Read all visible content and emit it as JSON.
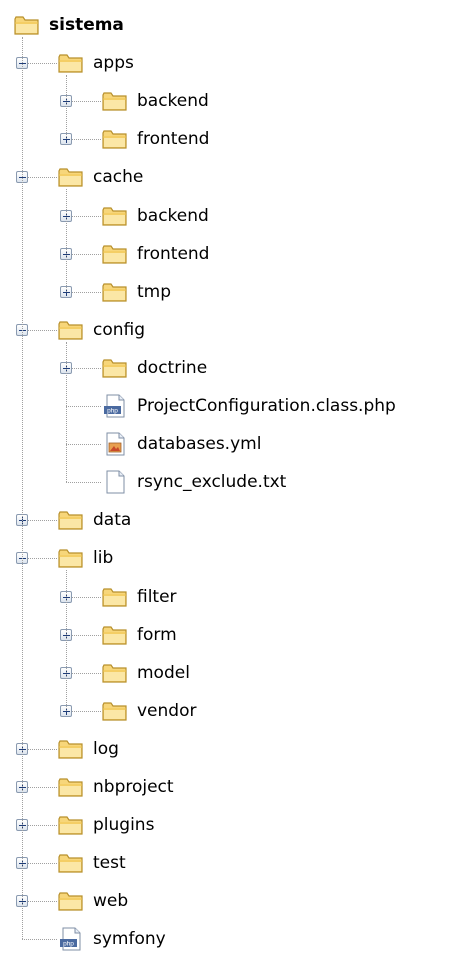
{
  "tree": {
    "root": {
      "label": "sistema",
      "icon": "folder-open-icon",
      "expanded": true
    },
    "items": [
      {
        "label": "apps",
        "icon": "folder-icon",
        "type": "folder",
        "expanded": true,
        "children": [
          {
            "label": "backend",
            "icon": "folder-icon",
            "type": "folder",
            "expanded": false
          },
          {
            "label": "frontend",
            "icon": "folder-icon",
            "type": "folder",
            "expanded": false
          }
        ]
      },
      {
        "label": "cache",
        "icon": "folder-icon",
        "type": "folder",
        "expanded": true,
        "children": [
          {
            "label": "backend",
            "icon": "folder-icon",
            "type": "folder",
            "expanded": false
          },
          {
            "label": "frontend",
            "icon": "folder-icon",
            "type": "folder",
            "expanded": false
          },
          {
            "label": "tmp",
            "icon": "folder-icon",
            "type": "folder",
            "expanded": false
          }
        ]
      },
      {
        "label": "config",
        "icon": "folder-icon",
        "type": "folder",
        "expanded": true,
        "children": [
          {
            "label": "doctrine",
            "icon": "folder-icon",
            "type": "folder",
            "expanded": false
          },
          {
            "label": "ProjectConfiguration.class.php",
            "icon": "php-file-icon",
            "type": "file"
          },
          {
            "label": "databases.yml",
            "icon": "yml-file-icon",
            "type": "file"
          },
          {
            "label": "rsync_exclude.txt",
            "icon": "text-file-icon",
            "type": "file"
          }
        ]
      },
      {
        "label": "data",
        "icon": "folder-icon",
        "type": "folder",
        "expanded": false
      },
      {
        "label": "lib",
        "icon": "folder-icon",
        "type": "folder",
        "expanded": true,
        "children": [
          {
            "label": "filter",
            "icon": "folder-icon",
            "type": "folder",
            "expanded": false
          },
          {
            "label": "form",
            "icon": "folder-icon",
            "type": "folder",
            "expanded": false
          },
          {
            "label": "model",
            "icon": "folder-icon",
            "type": "folder",
            "expanded": false
          },
          {
            "label": "vendor",
            "icon": "folder-icon",
            "type": "folder",
            "expanded": false
          }
        ]
      },
      {
        "label": "log",
        "icon": "folder-icon",
        "type": "folder",
        "expanded": false
      },
      {
        "label": "nbproject",
        "icon": "folder-icon",
        "type": "folder",
        "expanded": false
      },
      {
        "label": "plugins",
        "icon": "folder-icon",
        "type": "folder",
        "expanded": false
      },
      {
        "label": "test",
        "icon": "folder-icon",
        "type": "folder",
        "expanded": false
      },
      {
        "label": "web",
        "icon": "folder-icon",
        "type": "folder",
        "expanded": false
      },
      {
        "label": "symfony",
        "icon": "php-file-icon",
        "type": "file"
      }
    ]
  },
  "colors": {
    "folder_fill": "#f7d67a",
    "folder_stroke": "#b8902c",
    "folder_tab": "#f0c650",
    "line": "#a0a0a0",
    "expander_border": "#8a9ab0",
    "expander_glyph": "#1e3c78",
    "php_badge": "#4a6aa0"
  }
}
